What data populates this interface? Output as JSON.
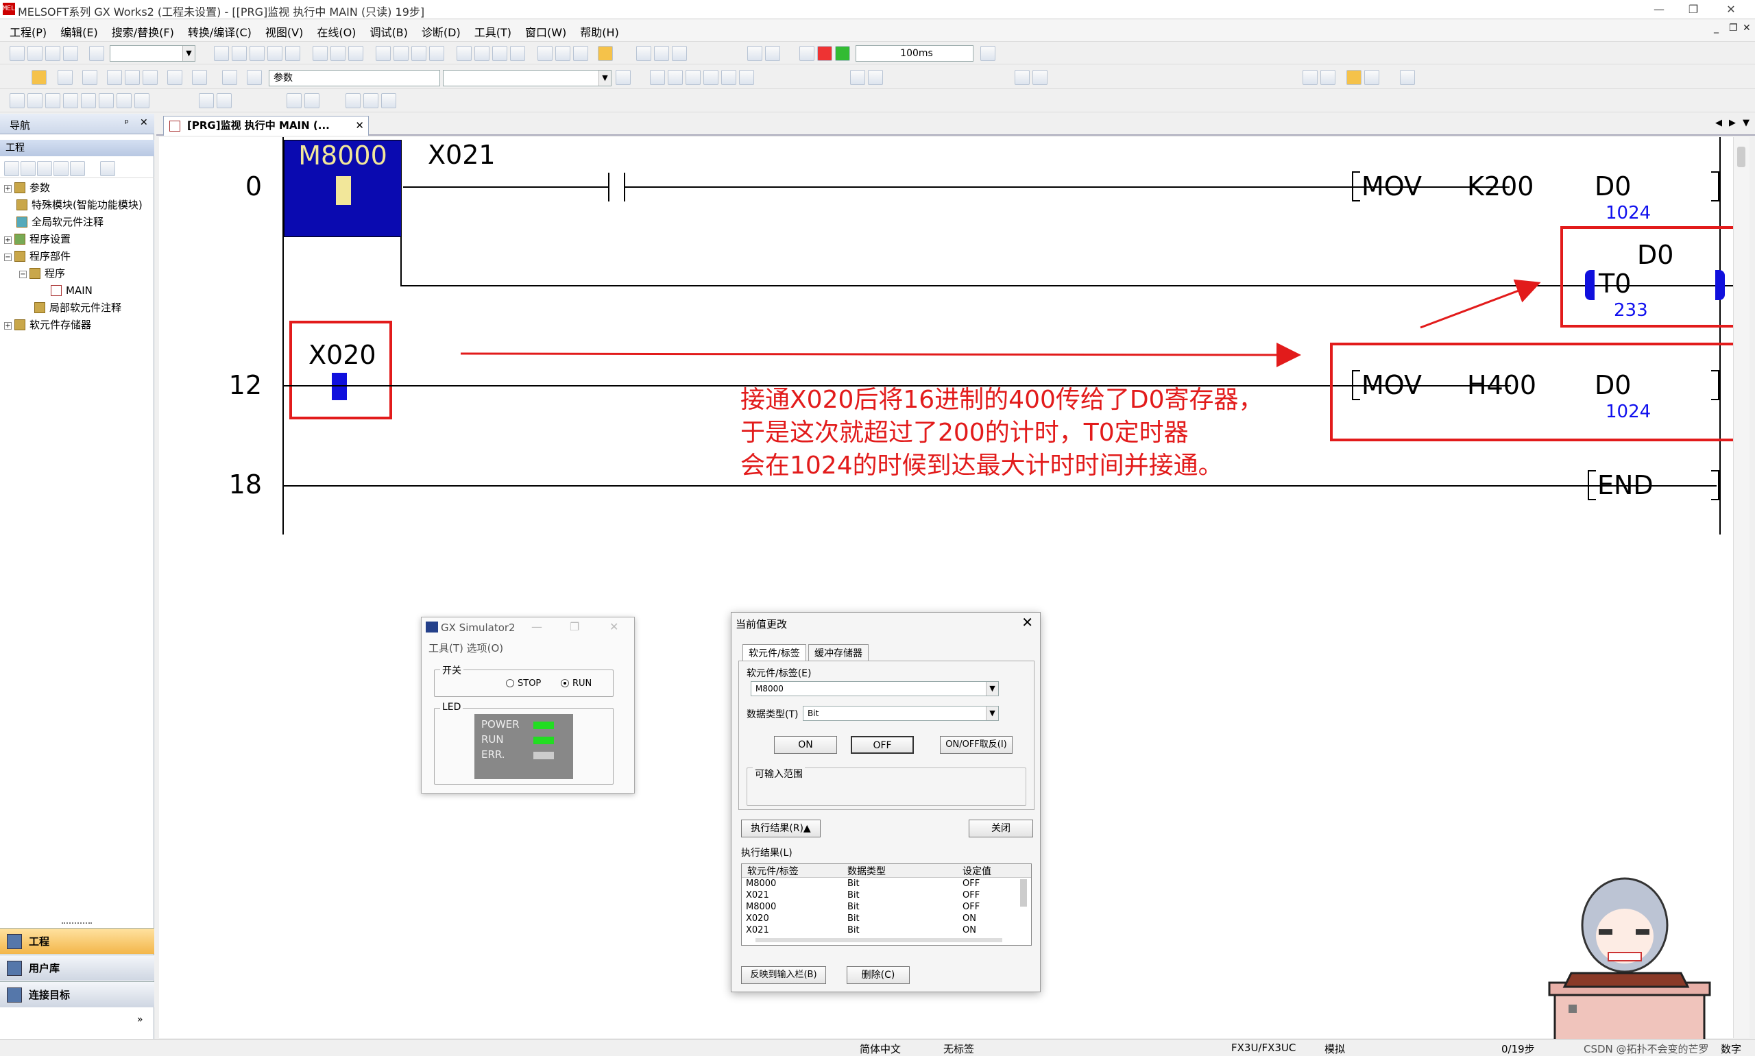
{
  "window": {
    "app_icon": "MEL",
    "title": "MELSOFT系列 GX Works2 (工程未设置) - [[PRG]监视 执行中 MAIN (只读) 19步]",
    "min": "—",
    "restore": "❐",
    "close": "✕"
  },
  "menu": [
    "工程(P)",
    "编辑(E)",
    "搜索/替换(F)",
    "转换/编译(C)",
    "视图(V)",
    "在线(O)",
    "调试(B)",
    "诊断(D)",
    "工具(T)",
    "窗口(W)",
    "帮助(H)"
  ],
  "mdi": {
    "min": "_",
    "restore": "❐",
    "close": "✕"
  },
  "toolbar": {
    "scan_time": "100ms",
    "param_select": "参数"
  },
  "nav": {
    "title": "导航",
    "pin": "ᵖ",
    "close": "✕",
    "section": "工程",
    "tree": [
      "参数",
      "特殊模块(智能功能模块)",
      "全局软元件注释",
      "程序设置",
      "程序部件",
      "程序",
      "MAIN",
      "局部软元件注释",
      "软元件存储器"
    ],
    "buttons": [
      "工程",
      "用户库",
      "连接目标"
    ]
  },
  "tab": {
    "label": "[PRG]监视 执行中 MAIN (...",
    "close": "✕"
  },
  "ladder": {
    "steps": [
      "0",
      "12",
      "18"
    ],
    "contacts": {
      "m8000": "M8000",
      "x021": "X021",
      "x020": "X020"
    },
    "rung0_mov": {
      "op": "MOV",
      "src": "K200",
      "dst": "D0",
      "mon": "1024"
    },
    "timer": {
      "coil": "T0",
      "setting": "D0",
      "mon": "233"
    },
    "rung12_mov": {
      "op": "MOV",
      "src": "H400",
      "dst": "D0",
      "mon": "1024"
    },
    "end": "END"
  },
  "annotation": [
    "接通X020后将16进制的400传给了D0寄存器，",
    "于是这次就超过了200的计时，T0定时器",
    "会在1024的时候到达最大计时时间并接通。"
  ],
  "sim": {
    "title": "GX Simulator2",
    "menu": "工具(T)   选项(O)",
    "switch_group": "开关",
    "stop": "STOP",
    "run": "RUN",
    "led_group": "LED",
    "leds": [
      "POWER",
      "RUN",
      "ERR."
    ],
    "led_colors": [
      "#22dd22",
      "#22dd22",
      "#cccccc"
    ]
  },
  "dialog": {
    "title": "当前值更改",
    "close": "✕",
    "tabs": [
      "软元件/标签",
      "缓冲存储器"
    ],
    "device_label": "软元件/标签(E)",
    "device_value": "M8000",
    "type_label": "数据类型(T)",
    "type_value": "Bit",
    "btn_on": "ON",
    "btn_off": "OFF",
    "btn_toggle": "ON/OFF取反(I)",
    "range_label": "可输入范围",
    "exec_btn": "执行结果(R)▲",
    "close_btn": "关闭",
    "result_label": "执行结果(L)",
    "cols": [
      "软元件/标签",
      "数据类型",
      "设定值"
    ],
    "rows": [
      [
        "M8000",
        "Bit",
        "OFF"
      ],
      [
        "X021",
        "Bit",
        "OFF"
      ],
      [
        "M8000",
        "Bit",
        "OFF"
      ],
      [
        "X020",
        "Bit",
        "ON"
      ],
      [
        "X021",
        "Bit",
        "ON"
      ]
    ],
    "reflect_btn": "反映到输入栏(B)",
    "delete_btn": "删除(C)"
  },
  "status": {
    "lang": "简体中文",
    "label": "无标签",
    "plc": "FX3U/FX3UC",
    "mode": "模拟",
    "steps": "0/19步",
    "watermark": "CSDN @拓扑不会变的芒罗",
    "numlock": "数字"
  }
}
